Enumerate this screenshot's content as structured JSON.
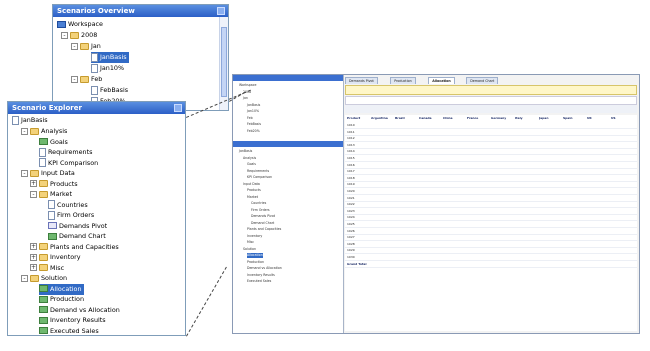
{
  "overview": {
    "title": "Scenarios Overview",
    "items": [
      "Workspace",
      "2008",
      "Jan",
      "JanBasis",
      "Jan10%",
      "Feb",
      "FebBasis",
      "Feb20%"
    ],
    "selected": "JanBasis"
  },
  "explorer": {
    "title": "Scenario Explorer",
    "root": "JanBasis",
    "items": [
      {
        "label": "Analysis",
        "icon": "folder",
        "level": 1,
        "exp": "-"
      },
      {
        "label": "Goals",
        "icon": "goal",
        "level": 2
      },
      {
        "label": "Requirements",
        "icon": "doc",
        "level": 2
      },
      {
        "label": "KPI Comparison",
        "icon": "doc",
        "level": 2
      },
      {
        "label": "Input Data",
        "icon": "folder",
        "level": 1,
        "exp": "-"
      },
      {
        "label": "Products",
        "icon": "folder",
        "level": 2,
        "exp": "+"
      },
      {
        "label": "Market",
        "icon": "folder",
        "level": 2,
        "exp": "-"
      },
      {
        "label": "Countries",
        "icon": "doc",
        "level": 3
      },
      {
        "label": "Firm Orders",
        "icon": "doc",
        "level": 3
      },
      {
        "label": "Demands Pivot",
        "icon": "grid",
        "level": 3
      },
      {
        "label": "Demand Chart",
        "icon": "chart",
        "level": 3
      },
      {
        "label": "Plants and Capacities",
        "icon": "folder",
        "level": 2,
        "exp": "+"
      },
      {
        "label": "Inventory",
        "icon": "folder",
        "level": 2,
        "exp": "+"
      },
      {
        "label": "Misc",
        "icon": "folder",
        "level": 2,
        "exp": "+"
      },
      {
        "label": "Solution",
        "icon": "folder",
        "level": 1,
        "exp": "-"
      },
      {
        "label": "Allocation",
        "icon": "chart",
        "level": 2,
        "selected": true
      },
      {
        "label": "Production",
        "icon": "chart",
        "level": 2
      },
      {
        "label": "Demand vs Allocation",
        "icon": "chart",
        "level": 2
      },
      {
        "label": "Inventory Results",
        "icon": "chart",
        "level": 2
      },
      {
        "label": "Executed Sales",
        "icon": "chart",
        "level": 2
      }
    ]
  },
  "main": {
    "tabs": [
      "Demands Pivot",
      "Production",
      "Allocation",
      "Demand Chart"
    ],
    "active_tab": "Allocation",
    "columns": [
      "Product",
      "Argentina",
      "Brazil",
      "Canada",
      "China",
      "France",
      "Germany",
      "Italy",
      "Japan",
      "Spain",
      "UK",
      "US"
    ],
    "rows": [
      "1010",
      "1011",
      "1012",
      "1013",
      "1014",
      "1015",
      "1016",
      "1017",
      "1018",
      "1019",
      "1020",
      "1021",
      "1022",
      "1023",
      "1024",
      "1025",
      "1026",
      "1027",
      "1028",
      "1029",
      "1030",
      "Grand Total"
    ]
  },
  "colors": {
    "title_start": "#5a8fe0",
    "title_end": "#2b5fc7",
    "selected": "#316ac5"
  }
}
